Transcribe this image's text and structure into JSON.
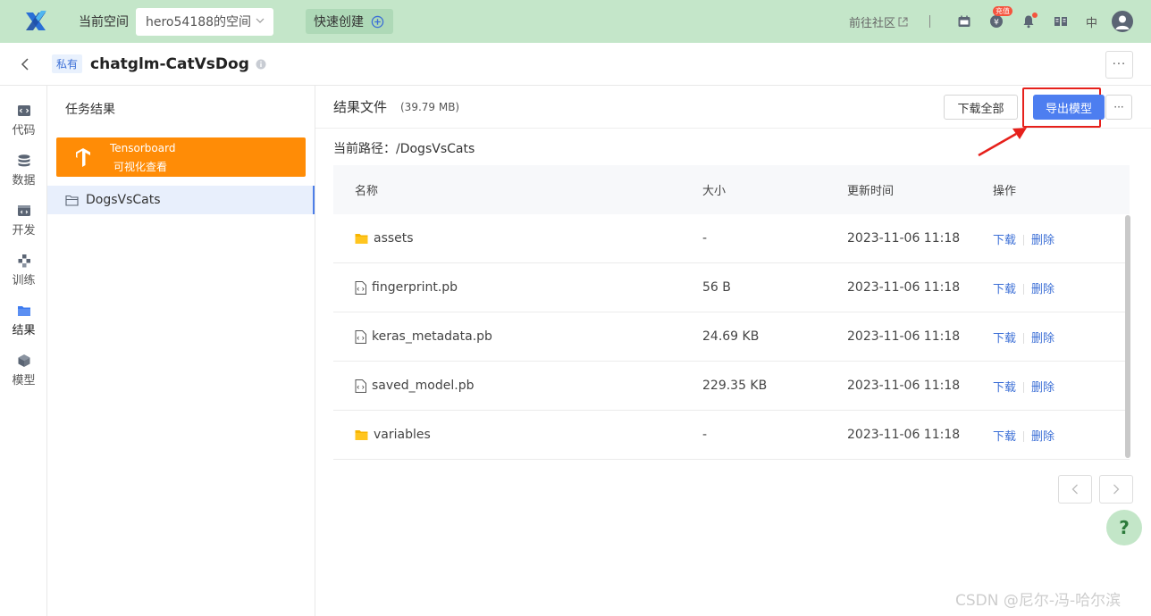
{
  "header": {
    "space_label": "当前空间",
    "space_value": "hero54188的空间",
    "quick_create": "快速创建",
    "community": "前往社区",
    "recharge_badge": "充值",
    "language": "中"
  },
  "titlebar": {
    "private_tag": "私有",
    "project_title": "chatglm-CatVsDog",
    "more": "···"
  },
  "nav": {
    "items": [
      {
        "label": "代码",
        "icon": "code-icon"
      },
      {
        "label": "数据",
        "icon": "database-icon"
      },
      {
        "label": "开发",
        "icon": "dev-icon"
      },
      {
        "label": "训练",
        "icon": "train-icon"
      },
      {
        "label": "结果",
        "icon": "folder-icon"
      },
      {
        "label": "模型",
        "icon": "cube-icon"
      }
    ]
  },
  "sidebar": {
    "title": "任务结果",
    "tensorboard_line1": "Tensorboard",
    "tensorboard_line2": "可视化查看",
    "folder": "DogsVsCats"
  },
  "main": {
    "title": "结果文件",
    "size": "(39.79 MB)",
    "download_all": "下载全部",
    "export_model": "导出模型",
    "more": "···",
    "path_label": "当前路径：/DogsVsCats",
    "columns": [
      "名称",
      "大小",
      "更新时间",
      "操作"
    ],
    "rows": [
      {
        "name": "assets",
        "type": "folder",
        "size": "-",
        "time": "2023-11-06 11:18"
      },
      {
        "name": "fingerprint.pb",
        "type": "file",
        "size": "56 B",
        "time": "2023-11-06 11:18"
      },
      {
        "name": "keras_metadata.pb",
        "type": "file",
        "size": "24.69 KB",
        "time": "2023-11-06 11:18"
      },
      {
        "name": "saved_model.pb",
        "type": "file",
        "size": "229.35 KB",
        "time": "2023-11-06 11:18"
      },
      {
        "name": "variables",
        "type": "folder",
        "size": "-",
        "time": "2023-11-06 11:18"
      }
    ],
    "action_download": "下载",
    "action_delete": "删除",
    "help": "?"
  },
  "watermark": "CSDN @尼尔-冯-哈尔滨",
  "colors": {
    "topbar": "#c4e6c9",
    "primary": "#4d7ef0",
    "tensorboard": "#ff8c06",
    "highlight": "#e6201b"
  }
}
